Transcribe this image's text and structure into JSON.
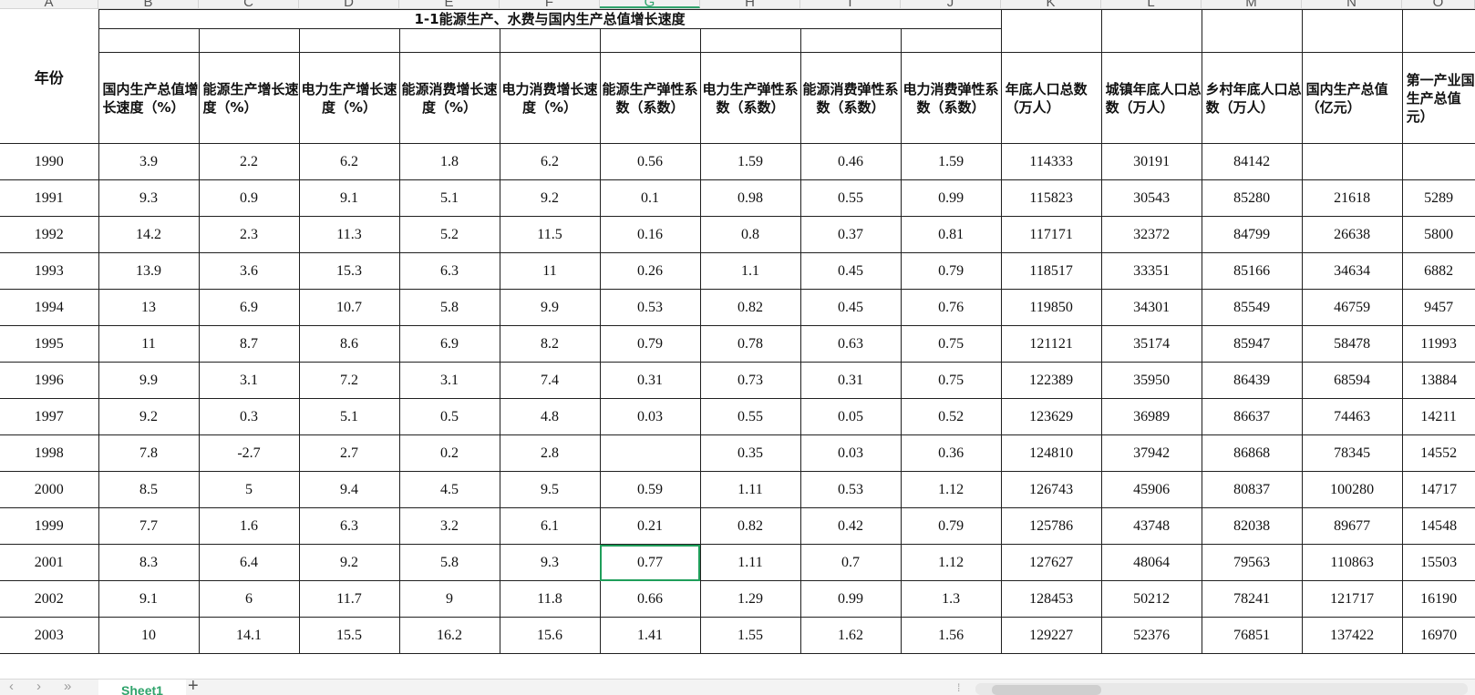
{
  "column_letters": [
    {
      "label": "A",
      "w": 108
    },
    {
      "label": "B",
      "w": 110
    },
    {
      "label": "C",
      "w": 110
    },
    {
      "label": "D",
      "w": 110
    },
    {
      "label": "E",
      "w": 110
    },
    {
      "label": "F",
      "w": 110
    },
    {
      "label": "G",
      "w": 110
    },
    {
      "label": "H",
      "w": 110
    },
    {
      "label": "I",
      "w": 110
    },
    {
      "label": "J",
      "w": 110
    },
    {
      "label": "K",
      "w": 110
    },
    {
      "label": "L",
      "w": 110
    },
    {
      "label": "M",
      "w": 110
    },
    {
      "label": "N",
      "w": 110
    },
    {
      "label": "O",
      "w": 80
    }
  ],
  "selected_column": "G",
  "table": {
    "title": "1-1能源生产、水费与国内生产总值增长速度",
    "year_header": "年份",
    "headers": [
      "国内生产总值增长速度（%）",
      "能源生产增长速度（%）",
      "电力生产增长速度（%）",
      "能源消费增长速度（%）",
      "电力消费增长速度（%）",
      "能源生产弹性系数（系数）",
      "电力生产弹性系数（系数）",
      "能源消费弹性系数（系数）",
      "电力消费弹性系数（系数）",
      "年底人口总数（万人）",
      "城镇年底人口总数（万人）",
      "乡村年底人口总数（万人）",
      "国内生产总值（亿元）",
      "第一产业国生产总值元）"
    ],
    "rows": [
      [
        "1990",
        "3.9",
        "2.2",
        "6.2",
        "1.8",
        "6.2",
        "0.56",
        "1.59",
        "0.46",
        "1.59",
        "114333",
        "30191",
        "84142",
        "",
        ""
      ],
      [
        "1991",
        "9.3",
        "0.9",
        "9.1",
        "5.1",
        "9.2",
        "0.1",
        "0.98",
        "0.55",
        "0.99",
        "115823",
        "30543",
        "85280",
        "21618",
        "5289"
      ],
      [
        "1992",
        "14.2",
        "2.3",
        "11.3",
        "5.2",
        "11.5",
        "0.16",
        "0.8",
        "0.37",
        "0.81",
        "117171",
        "32372",
        "84799",
        "26638",
        "5800"
      ],
      [
        "1993",
        "13.9",
        "3.6",
        "15.3",
        "6.3",
        "11",
        "0.26",
        "1.1",
        "0.45",
        "0.79",
        "118517",
        "33351",
        "85166",
        "34634",
        "6882"
      ],
      [
        "1994",
        "13",
        "6.9",
        "10.7",
        "5.8",
        "9.9",
        "0.53",
        "0.82",
        "0.45",
        "0.76",
        "119850",
        "34301",
        "85549",
        "46759",
        "9457"
      ],
      [
        "1995",
        "11",
        "8.7",
        "8.6",
        "6.9",
        "8.2",
        "0.79",
        "0.78",
        "0.63",
        "0.75",
        "121121",
        "35174",
        "85947",
        "58478",
        "11993"
      ],
      [
        "1996",
        "9.9",
        "3.1",
        "7.2",
        "3.1",
        "7.4",
        "0.31",
        "0.73",
        "0.31",
        "0.75",
        "122389",
        "35950",
        "86439",
        "68594",
        "13884"
      ],
      [
        "1997",
        "9.2",
        "0.3",
        "5.1",
        "0.5",
        "4.8",
        "0.03",
        "0.55",
        "0.05",
        "0.52",
        "123629",
        "36989",
        "86637",
        "74463",
        "14211"
      ],
      [
        "1998",
        "7.8",
        "-2.7",
        "2.7",
        "0.2",
        "2.8",
        "",
        "0.35",
        "0.03",
        "0.36",
        "124810",
        "37942",
        "86868",
        "78345",
        "14552"
      ],
      [
        "2000",
        "8.5",
        "5",
        "9.4",
        "4.5",
        "9.5",
        "0.59",
        "1.11",
        "0.53",
        "1.12",
        "126743",
        "45906",
        "80837",
        "100280",
        "14717"
      ],
      [
        "1999",
        "7.7",
        "1.6",
        "6.3",
        "3.2",
        "6.1",
        "0.21",
        "0.82",
        "0.42",
        "0.79",
        "125786",
        "43748",
        "82038",
        "89677",
        "14548"
      ],
      [
        "2001",
        "8.3",
        "6.4",
        "9.2",
        "5.8",
        "9.3",
        "0.77",
        "1.11",
        "0.7",
        "1.12",
        "127627",
        "48064",
        "79563",
        "110863",
        "15503"
      ],
      [
        "2002",
        "9.1",
        "6",
        "11.7",
        "9",
        "11.8",
        "0.66",
        "1.29",
        "0.99",
        "1.3",
        "128453",
        "50212",
        "78241",
        "121717",
        "16190"
      ],
      [
        "2003",
        "10",
        "14.1",
        "15.5",
        "16.2",
        "15.6",
        "1.41",
        "1.55",
        "1.62",
        "1.56",
        "129227",
        "52376",
        "76851",
        "137422",
        "16970"
      ]
    ],
    "active_cell": {
      "row": 11,
      "col": 6
    }
  },
  "sheet_tabs": {
    "active": "Sheet1",
    "add_label": "+",
    "nav": [
      "‹",
      "›",
      "»"
    ]
  }
}
